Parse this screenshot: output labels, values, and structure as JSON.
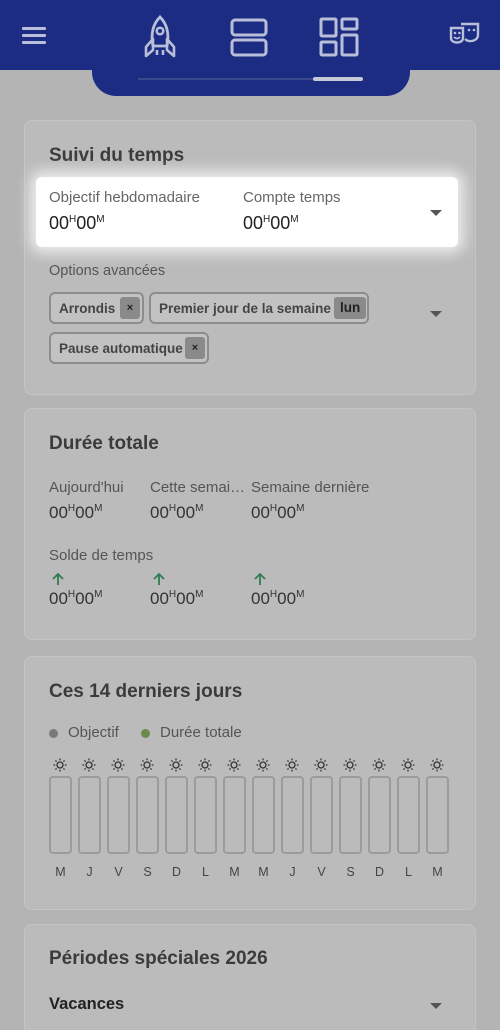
{
  "colors": {
    "topbar": "#1b2c82",
    "background": "#b4b4b4",
    "card": "#bbbbbb",
    "accent_green": "#2e7d52",
    "legend_objective": "#7a7a7a",
    "legend_total": "#6a8a4a"
  },
  "topbar": {
    "icons": [
      "menu-icon",
      "rocket-icon",
      "rows-icon",
      "dashboard-icon",
      "theater-mask-icon"
    ]
  },
  "time_tracking": {
    "title": "Suivi du temps",
    "weekly_goal_label": "Objectif hebdomadaire",
    "weekly_goal_h": "00",
    "weekly_goal_m": "00",
    "counter_label": "Compte temps",
    "counter_h": "00",
    "counter_m": "00",
    "advanced_label": "Options avancées",
    "chips": {
      "rounding": "Arrondis",
      "first_day": "Premier jour de la semaine",
      "first_day_value": "lun",
      "auto_pause": "Pause automatique"
    }
  },
  "unit": {
    "h": "H",
    "m": "M",
    "remove": "×"
  },
  "total": {
    "title": "Durée totale",
    "today": "Aujourd'hui",
    "this_week": "Cette semai…",
    "last_week": "Semaine dernière",
    "balance_label": "Solde de temps",
    "values": [
      {
        "h": "00",
        "m": "00"
      },
      {
        "h": "00",
        "m": "00"
      },
      {
        "h": "00",
        "m": "00"
      },
      {
        "h": "00",
        "m": "00"
      },
      {
        "h": "00",
        "m": "00"
      },
      {
        "h": "00",
        "m": "00"
      }
    ]
  },
  "last14": {
    "title": "Ces 14 derniers jours",
    "legend_objective": "Objectif",
    "legend_total": "Durée totale",
    "days": [
      "M",
      "J",
      "V",
      "S",
      "D",
      "L",
      "M",
      "M",
      "J",
      "V",
      "S",
      "D",
      "L",
      "M"
    ]
  },
  "special": {
    "title": "Périodes spéciales 2026",
    "vacations": "Vacances"
  }
}
